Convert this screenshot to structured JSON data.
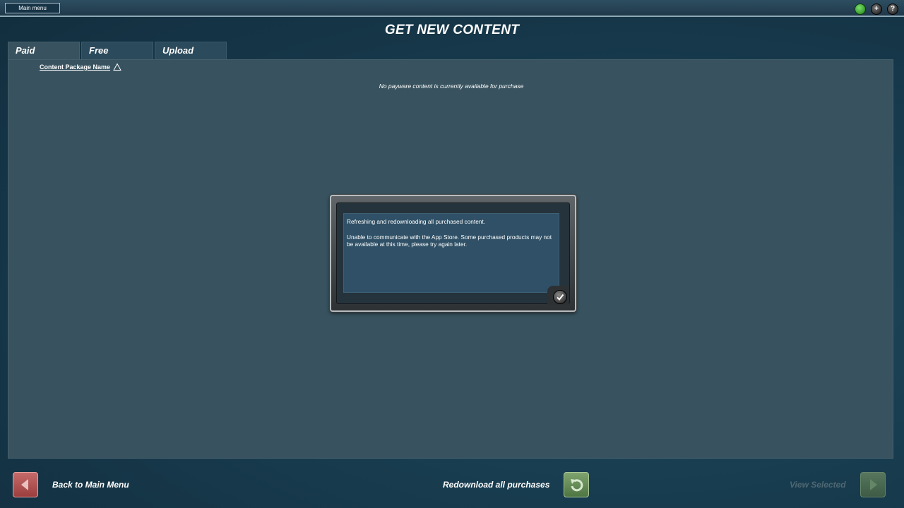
{
  "topbar": {
    "main_menu_label": "Main menu",
    "icons": [
      "green-status-icon",
      "plus-icon",
      "help-icon"
    ],
    "icon_glyphs": {
      "plus": "+",
      "help": "?"
    }
  },
  "page_title": "GET NEW CONTENT",
  "tabs": [
    {
      "label": "Paid",
      "active": true
    },
    {
      "label": "Free",
      "active": false
    },
    {
      "label": "Upload",
      "active": false
    }
  ],
  "list": {
    "column_header": "Content Package Name",
    "empty_message": "No payware content is currently available for purchase"
  },
  "dialog": {
    "line1": "Refreshing and redownloading all purchased content.",
    "line2": "Unable to communicate with the App Store. Some purchased products may not be available at this time, please try again later."
  },
  "bottom": {
    "back_label": "Back to Main Menu",
    "redownload_label": "Redownload all purchases",
    "view_selected_label": "View Selected",
    "view_selected_enabled": false
  },
  "colors": {
    "background": "#183c4f",
    "panel": "#38535f",
    "back_button": "#b35555",
    "action_button": "#6a8f5b"
  }
}
